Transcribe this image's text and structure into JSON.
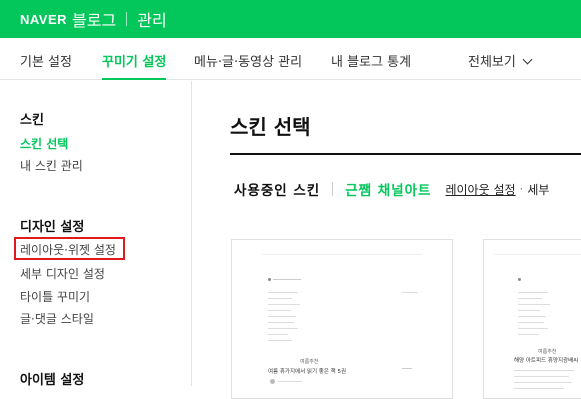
{
  "header": {
    "logo": "NAVER",
    "brand": "블로그",
    "title": "관리"
  },
  "nav": {
    "tabs": [
      "기본 설정",
      "꾸미기 설정",
      "메뉴·글·동영상 관리",
      "내 블로그 통계"
    ],
    "view_all": "전체보기"
  },
  "sidebar": {
    "skin_heading": "스킨",
    "skin_select": "스킨 선택",
    "my_skin": "내 스킨 관리",
    "design_heading": "디자인 설정",
    "layout_widget": "레이아웃·위젯 설정",
    "detail_design": "세부 디자인 설정",
    "title_decor": "타이틀 꾸미기",
    "comment_style": "글·댓글 스타일",
    "item_heading": "아이템 설정"
  },
  "main": {
    "title": "스킨 선택",
    "using_skin_label": "사용중인 스킨",
    "skin_name": "근쨈 채널아트",
    "layout_link": "레이아웃 설정",
    "detail_link": "세부"
  },
  "thumbnails": {
    "thumb1_tag": "여름추천",
    "thumb1_title": "여름 휴가지에서 읽기 좋은 책 5권",
    "thumb2_tag": "여름추천",
    "thumb2_title": "해양 아트피드 휴양지광배씨"
  }
}
